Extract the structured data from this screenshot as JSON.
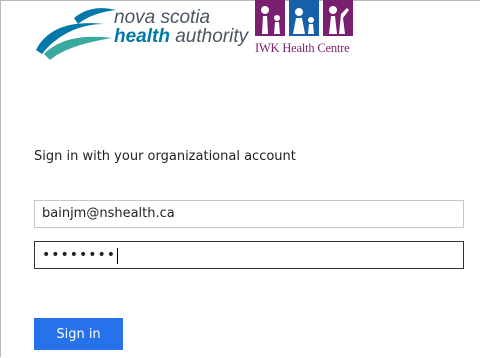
{
  "branding": {
    "nsha_line1": "nova scotia",
    "nsha_line2_bold": "health",
    "nsha_line2_rest": " authority",
    "iwk_name": "IWK Health Centre",
    "colors": {
      "nsha_teal": "#0079a8",
      "nsha_green": "#3aa9a0",
      "iwk_purple": "#7a1f6e",
      "iwk_blue": "#1560a8"
    }
  },
  "form": {
    "heading": "Sign in with your organizational account",
    "email_value": "bainjm@nshealth.ca",
    "password_mask": "••••••••",
    "signin_label": "Sign in"
  },
  "colors": {
    "button": "#2672ec"
  }
}
